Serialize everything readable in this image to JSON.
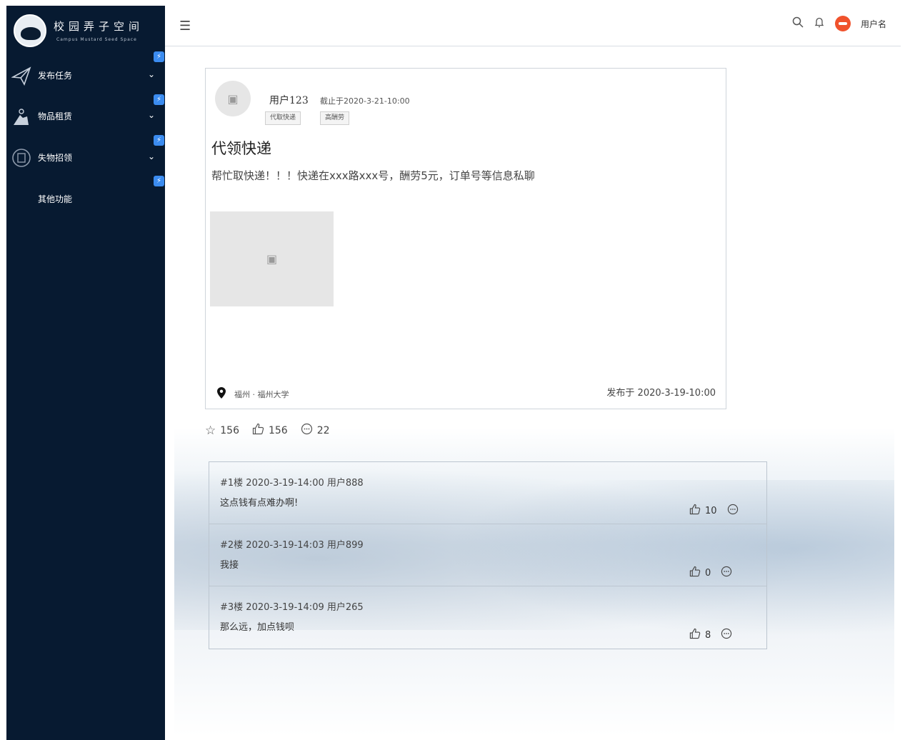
{
  "brand": {
    "title": "校园弄子空间",
    "subtitle": "Campus Mustard Seed Space"
  },
  "sidebar": {
    "items": [
      {
        "label": "发布任务",
        "icon": "paper-plane-icon",
        "expandable": true
      },
      {
        "label": "物品租赁",
        "icon": "rental-icon",
        "expandable": true
      },
      {
        "label": "失物招领",
        "icon": "lost-found-icon",
        "expandable": true
      },
      {
        "label": "其他功能",
        "icon": "",
        "expandable": false
      }
    ],
    "bolt_glyph": "⚡"
  },
  "header": {
    "toggle_icon": "menu-indent-icon",
    "username": "用户名"
  },
  "post": {
    "user": "用户123",
    "deadline": "截止于2020-3-21-10:00",
    "tags": [
      "代取快递",
      "高酬劳"
    ],
    "title": "代领快递",
    "body": "帮忙取快递！！！快递在xxx路xxx号，酬劳5元，订单号等信息私聊",
    "location": "福州 · 福州大学",
    "published": "发布于 2020-3-19-10:00"
  },
  "stats": {
    "favorites": "156",
    "likes": "156",
    "comments": "22"
  },
  "comments": [
    {
      "meta": "#1楼 2020-3-19-14:00 用户888",
      "text": "这点钱有点难办啊!",
      "likes": "10"
    },
    {
      "meta": "#2楼 2020-3-19-14:03 用户899",
      "text": "我接",
      "likes": "0"
    },
    {
      "meta": "#3楼 2020-3-19-14:09 用户265",
      "text": "那么远，加点钱呗",
      "likes": "8"
    }
  ],
  "colors": {
    "sidebar_bg": "#071a31",
    "accent": "#3b8cf0",
    "avatar": "#f0522c"
  }
}
